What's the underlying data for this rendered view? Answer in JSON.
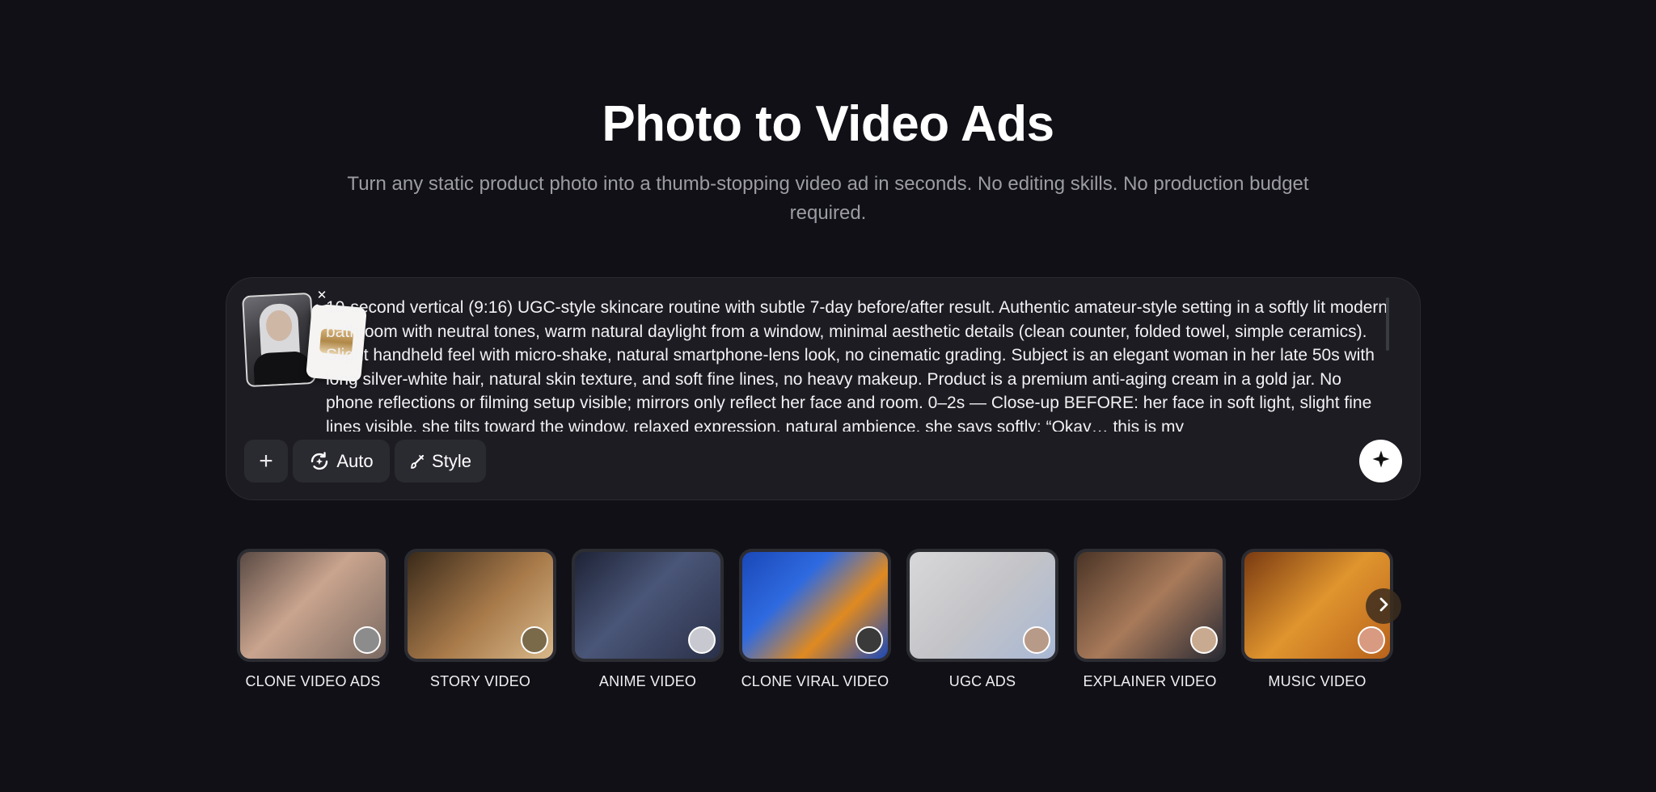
{
  "header": {
    "title": "Photo to Video Ads",
    "subtitle": "Turn any static product photo into a thumb-stopping video ad in seconds. No editing skills. No production budget required."
  },
  "composer": {
    "prompt_text": "10-second vertical (9:16) UGC-style skincare routine with subtle 7-day before/after result. Authentic amateur-style setting in a softly lit modern bathroom with neutral tones, warm natural daylight from a window, minimal aesthetic details (clean counter, folded towel, simple ceramics). Slight handheld feel with micro-shake, natural smartphone-lens look, no cinematic grading. Subject is an elegant woman in her late 50s with long silver-white hair, natural skin texture, and soft fine lines, no heavy makeup. Product is a premium anti-aging cream in a gold jar. No phone reflections or filming setup visible; mirrors only reflect her face and room. 0–2s — Close-up BEFORE: her face in soft light, slight fine lines visible, she tilts toward the window, relaxed expression, natural ambience, she says softly: “Okay… this is my",
    "close_label": "✕",
    "add_label": "+",
    "auto_label": "Auto",
    "style_label": "Style"
  },
  "cards": [
    {
      "label": "CLONE VIDEO ADS",
      "bg": "#8a7a70"
    },
    {
      "label": "STORY VIDEO",
      "bg": "#7a5a36"
    },
    {
      "label": "ANIME VIDEO",
      "bg": "#2e3548"
    },
    {
      "label": "CLONE VIRAL VIDEO",
      "bg": "#1f55c4"
    },
    {
      "label": "UGC ADS",
      "bg": "#cfcfd2"
    },
    {
      "label": "EXPLAINER VIDEO",
      "bg": "#6b4a35"
    },
    {
      "label": "MUSIC VIDEO",
      "bg": "#c77a2a"
    }
  ],
  "icons": {
    "close": "close-icon",
    "add": "plus-icon",
    "auto": "auto-cycle-icon",
    "style": "brush-icon",
    "send": "sparkle-icon",
    "next": "chevron-right-icon"
  },
  "colors": {
    "background": "#101016",
    "panel": "#1c1c22",
    "subtitle": "#9c9ca4"
  }
}
